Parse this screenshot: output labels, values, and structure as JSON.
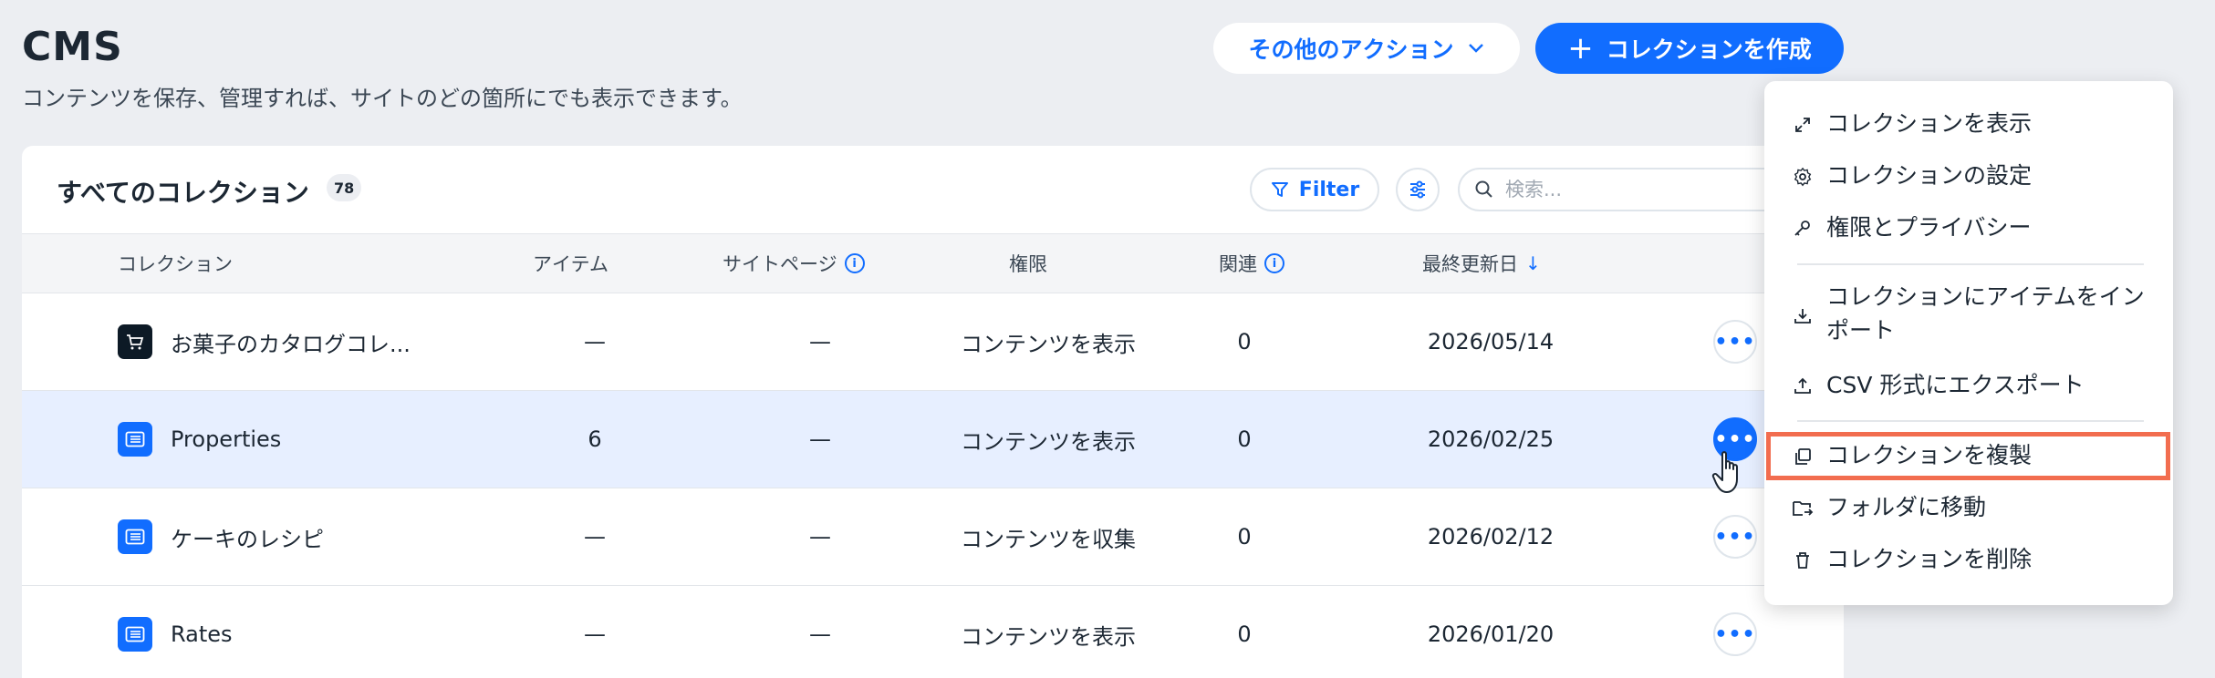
{
  "header": {
    "title": "CMS",
    "subtitle": "コンテンツを保存、管理すれば、サイトのどの箇所にでも表示できます。",
    "more_actions_label": "その他のアクション",
    "create_label": "コレクションを作成"
  },
  "card": {
    "title": "すべてのコレクション",
    "count": "78",
    "filter_label": "Filter",
    "search_placeholder": "検索..."
  },
  "table": {
    "columns": {
      "collection": "コレクション",
      "items": "アイテム",
      "site_pages": "サイトページ",
      "permissions": "権限",
      "related": "関連",
      "last_updated": "最終更新日"
    },
    "rows": [
      {
        "name": "お菓子のカタログコレ...",
        "items": "—",
        "site_pages": "—",
        "permissions": "コンテンツを表示",
        "related": "0",
        "last_updated": "2026/05/14",
        "icon": "cart-icon"
      },
      {
        "name": "Properties",
        "items": "6",
        "site_pages": "—",
        "permissions": "コンテンツを表示",
        "related": "0",
        "last_updated": "2026/02/25",
        "icon": "list-icon"
      },
      {
        "name": "ケーキのレシピ",
        "items": "—",
        "site_pages": "—",
        "permissions": "コンテンツを収集",
        "related": "0",
        "last_updated": "2026/02/12",
        "icon": "list-icon"
      },
      {
        "name": "Rates",
        "items": "—",
        "site_pages": "—",
        "permissions": "コンテンツを表示",
        "related": "0",
        "last_updated": "2026/01/20",
        "icon": "list-icon"
      }
    ]
  },
  "menu": {
    "items": [
      {
        "label": "コレクションを表示",
        "icon": "expand-icon"
      },
      {
        "label": "コレクションの設定",
        "icon": "gear-icon"
      },
      {
        "label": "権限とプライバシー",
        "icon": "key-icon"
      },
      {
        "label": "コレクションにアイテムをインポート",
        "icon": "import-icon"
      },
      {
        "label": "CSV 形式にエクスポート",
        "icon": "export-icon"
      },
      {
        "label": "コレクションを複製",
        "icon": "duplicate-icon"
      },
      {
        "label": "フォルダに移動",
        "icon": "move-folder-icon"
      },
      {
        "label": "コレクションを削除",
        "icon": "trash-icon"
      }
    ]
  },
  "colors": {
    "accent": "#116dff",
    "highlight": "#f26d4f",
    "selected_row": "#e7efff"
  }
}
